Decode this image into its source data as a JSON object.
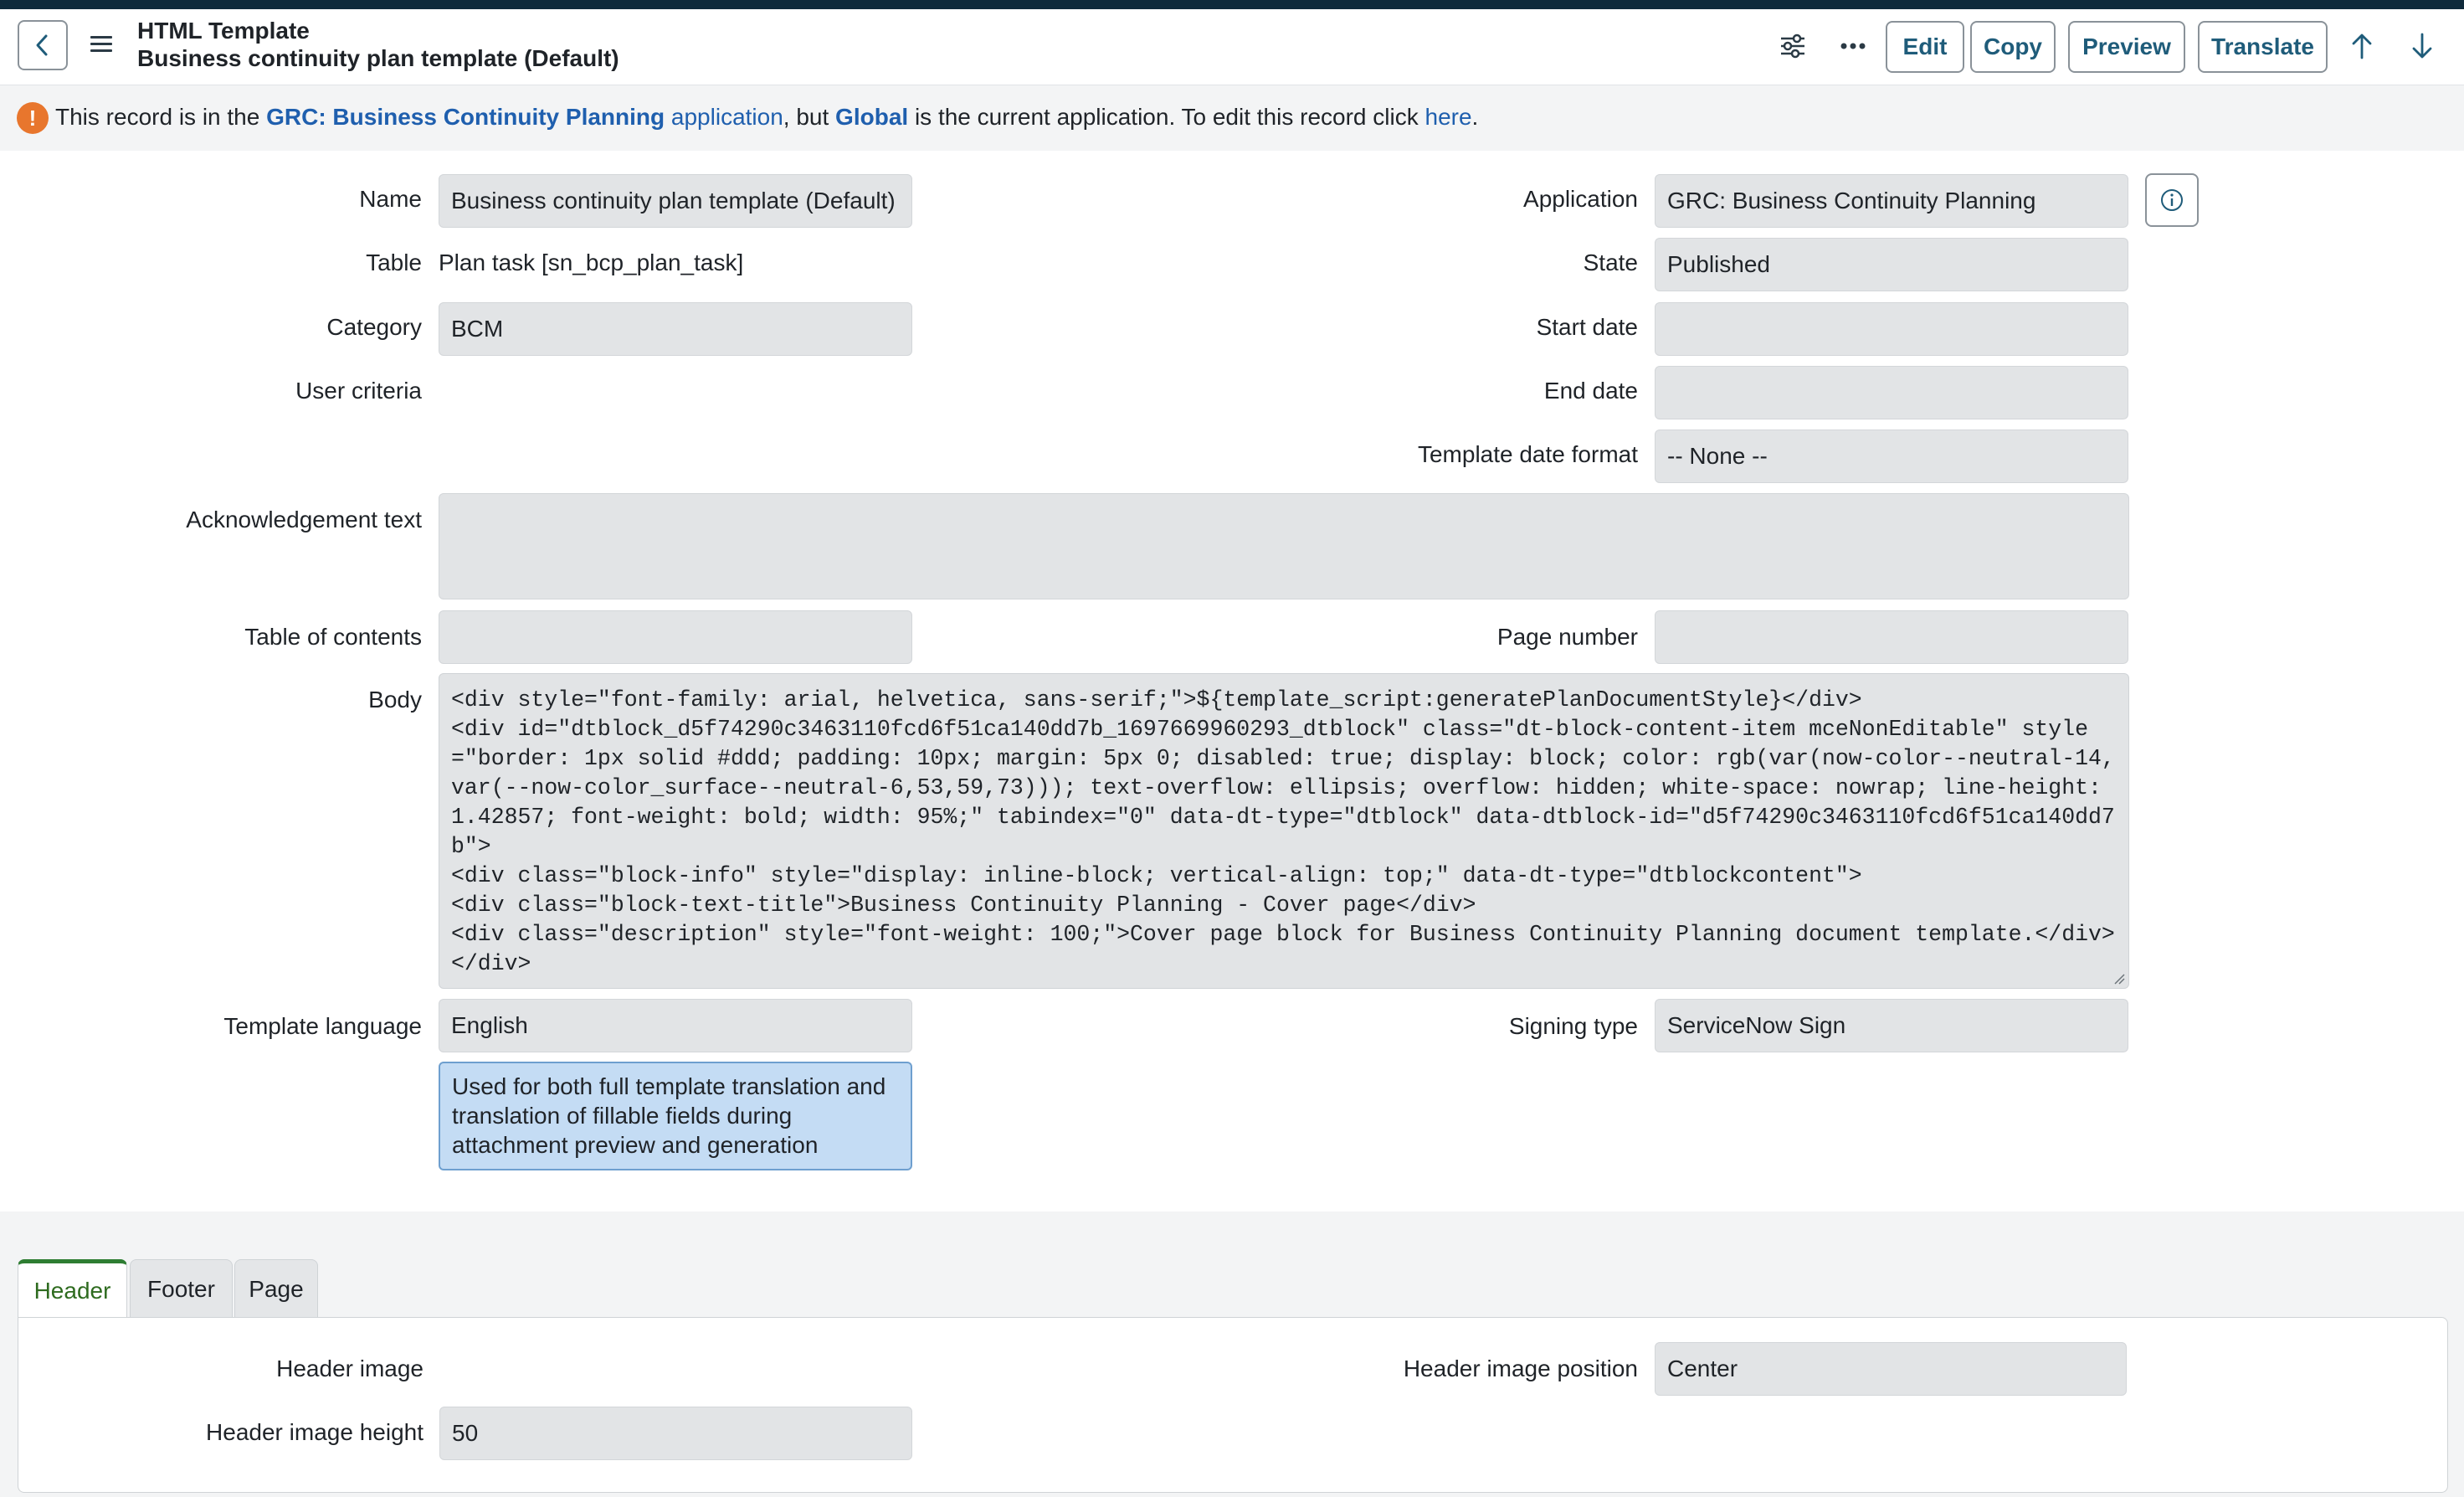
{
  "header": {
    "title": "HTML Template",
    "subtitle": "Business continuity plan template (Default)",
    "buttons": {
      "edit": "Edit",
      "copy": "Copy",
      "preview": "Preview",
      "translate": "Translate"
    }
  },
  "notice": {
    "text_1": "This record is in the ",
    "app_name": "GRC: Business Continuity Planning",
    "app_word": " application",
    "text_2": ", but ",
    "current_app": "Global",
    "text_3": " is the current application. To edit this record click ",
    "link": "here",
    "text_4": "."
  },
  "form": {
    "name": {
      "label": "Name",
      "value": "Business continuity plan template (Default)"
    },
    "application": {
      "label": "Application",
      "value": "GRC: Business Continuity Planning"
    },
    "table": {
      "label": "Table",
      "value": "Plan task [sn_bcp_plan_task]"
    },
    "state": {
      "label": "State",
      "value": "Published"
    },
    "category": {
      "label": "Category",
      "value": "BCM"
    },
    "start_date": {
      "label": "Start date",
      "value": ""
    },
    "user_criteria": {
      "label": "User criteria",
      "value": ""
    },
    "end_date": {
      "label": "End date",
      "value": ""
    },
    "template_date_format": {
      "label": "Template date format",
      "value": "-- None --"
    },
    "acknowledgement_text": {
      "label": "Acknowledgement text",
      "value": ""
    },
    "table_of_contents": {
      "label": "Table of contents",
      "value": ""
    },
    "page_number": {
      "label": "Page number",
      "value": ""
    },
    "body": {
      "label": "Body",
      "value": "<div style=\"font-family: arial, helvetica, sans-serif;\">${template_script:generatePlanDocumentStyle}</div>\n<div id=\"dtblock_d5f74290c3463110fcd6f51ca140dd7b_1697669960293_dtblock\" class=\"dt-block-content-item mceNonEditable\" style=\"border: 1px solid #ddd; padding: 10px; margin: 5px 0; disabled: true; display: block; color: rgb(var(now-color--neutral-14,var(--now-color_surface--neutral-6,53,59,73))); text-overflow: ellipsis; overflow: hidden; white-space: nowrap; line-height: 1.42857; font-weight: bold; width: 95%;\" tabindex=\"0\" data-dt-type=\"dtblock\" data-dtblock-id=\"d5f74290c3463110fcd6f51ca140dd7b\">\n<div class=\"block-info\" style=\"display: inline-block; vertical-align: top;\" data-dt-type=\"dtblockcontent\">\n<div class=\"block-text-title\">Business Continuity Planning - Cover page</div>\n<div class=\"description\" style=\"font-weight: 100;\">Cover page block for Business Continuity Planning document template.</div>\n</div>"
    },
    "template_language": {
      "label": "Template language",
      "value": "English",
      "hint": "Used for both full template translation and translation of fillable fields during attachment preview and generation"
    },
    "signing_type": {
      "label": "Signing type",
      "value": "ServiceNow Sign"
    }
  },
  "tabs": [
    {
      "label": "Header"
    },
    {
      "label": "Footer"
    },
    {
      "label": "Page"
    }
  ],
  "header_tab": {
    "header_image": {
      "label": "Header image",
      "value": ""
    },
    "header_image_position": {
      "label": "Header image position",
      "value": "Center"
    },
    "header_image_height": {
      "label": "Header image height",
      "value": "50"
    }
  }
}
